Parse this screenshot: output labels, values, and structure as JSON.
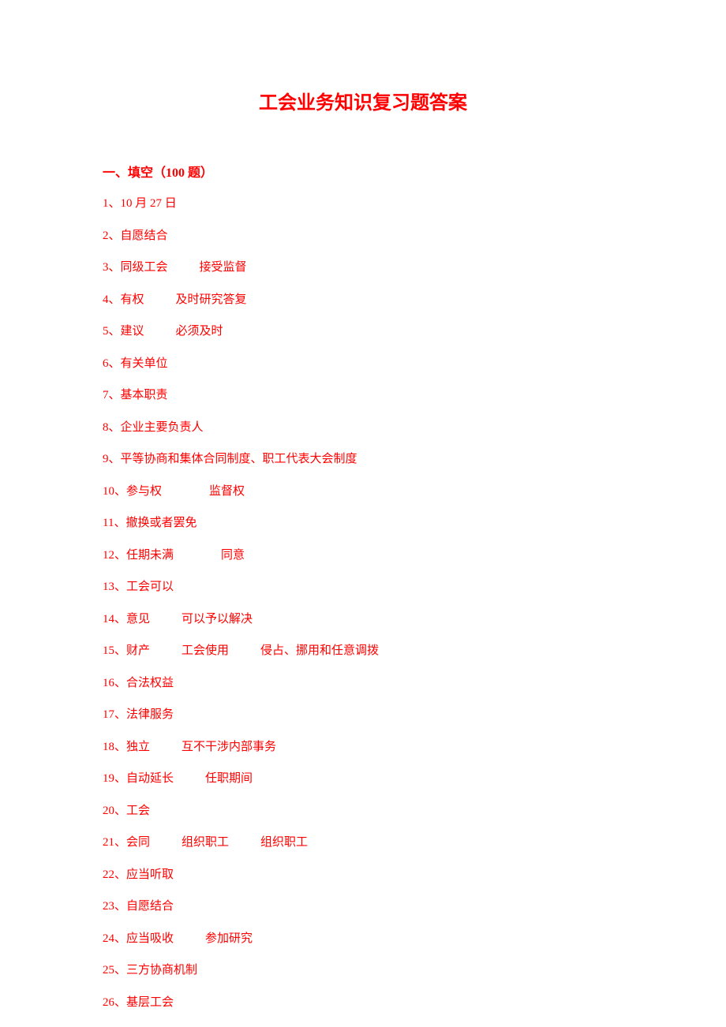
{
  "title": "工会业务知识复习题答案",
  "section_header": "一、填空（100 题）",
  "answers": {
    "a1": "1、10 月 27 日",
    "a2": "2、自愿结合",
    "a3_p1": "3、同级工会",
    "a3_p2": "接受监督",
    "a4_p1": "4、有权",
    "a4_p2": "及时研究答复",
    "a5_p1": "5、建议",
    "a5_p2": "必须及时",
    "a6": "6、有关单位",
    "a7": "7、基本职责",
    "a8": "8、企业主要负责人",
    "a9": "9、平等协商和集体合同制度、职工代表大会制度",
    "a10_p1": "10、参与权",
    "a10_p2": "监督权",
    "a11": "11、撤换或者罢免",
    "a12_p1": "12、任期未满",
    "a12_p2": "同意",
    "a13": "13、工会可以",
    "a14_p1": "14、意见",
    "a14_p2": "可以予以解决",
    "a15_p1": "15、财产",
    "a15_p2": "工会使用",
    "a15_p3": "侵占、挪用和任意调拨",
    "a16": "16、合法权益",
    "a17": "17、法律服务",
    "a18_p1": "18、独立",
    "a18_p2": "互不干涉内部事务",
    "a19_p1": "19、自动延长",
    "a19_p2": "任职期间",
    "a20": "20、工会",
    "a21_p1": "21、会同",
    "a21_p2": "组织职工",
    "a21_p3": "组织职工",
    "a22": "22、应当听取",
    "a23": "23、自愿结合",
    "a24_p1": "24、应当吸收",
    "a24_p2": "参加研究",
    "a25": "25、三方协商机制",
    "a26": "26、基层工会"
  }
}
